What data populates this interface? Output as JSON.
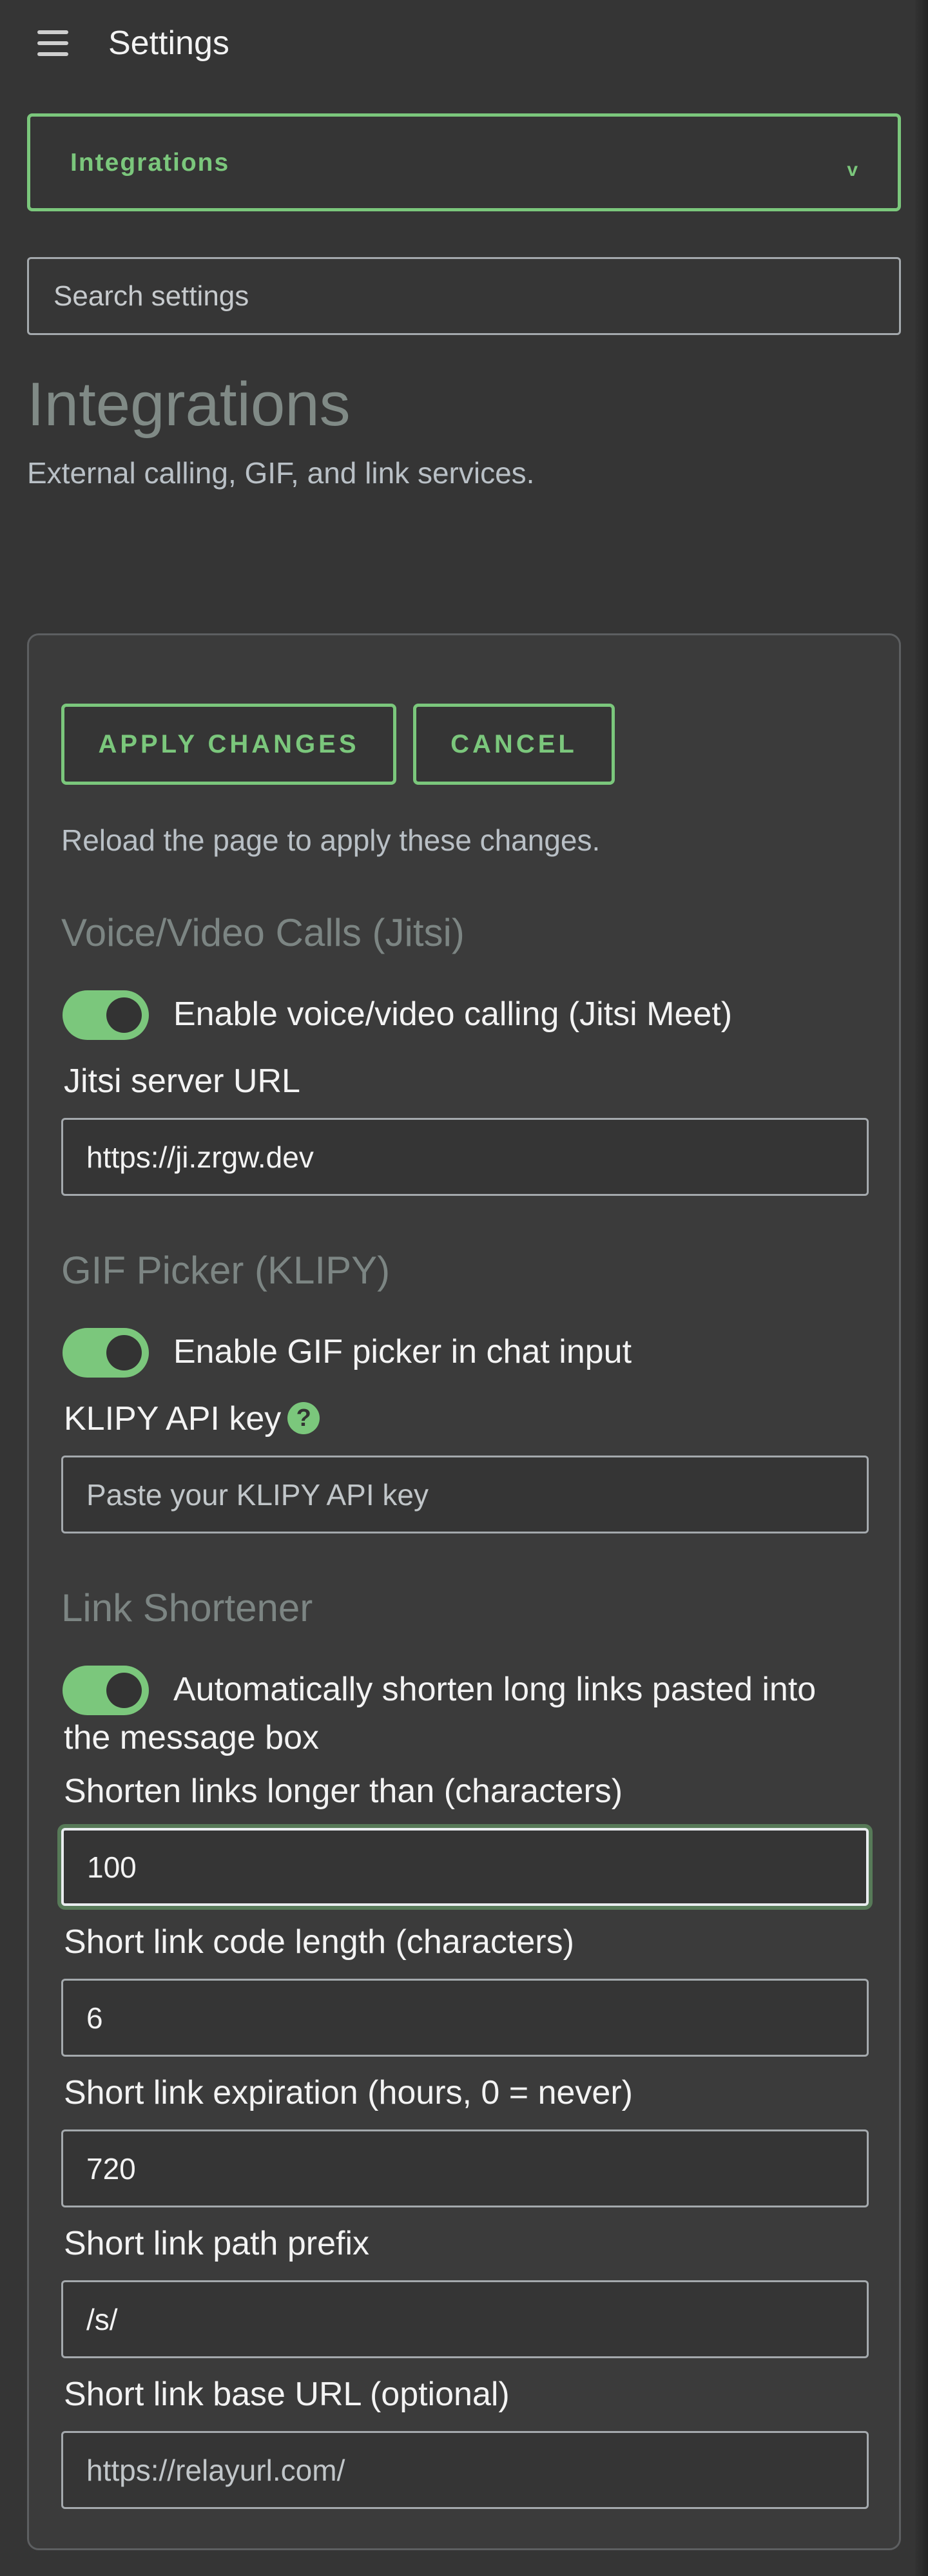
{
  "header": {
    "title": "Settings",
    "menu_icon": "hamburger-menu-icon"
  },
  "category_select": {
    "value": "Integrations",
    "chevron": "v"
  },
  "search": {
    "placeholder": "Search settings",
    "value": ""
  },
  "section": {
    "title": "Integrations",
    "description": "External calling, GIF, and link services."
  },
  "actions": {
    "apply_label": "APPLY CHANGES",
    "cancel_label": "CANCEL",
    "note": "Reload the page to apply these changes."
  },
  "jitsi": {
    "title": "Voice/Video Calls (Jitsi)",
    "toggle_label": "Enable voice/video calling (Jitsi Meet)",
    "toggle_on": true,
    "url_label": "Jitsi server URL",
    "url_value": "https://ji.zrgw.dev"
  },
  "gif": {
    "title": "GIF Picker (KLIPY)",
    "toggle_label": "Enable GIF picker in chat input",
    "toggle_on": true,
    "api_key_label": "KLIPY API key",
    "help_icon": "?",
    "api_key_placeholder": "Paste your KLIPY API key",
    "api_key_value": ""
  },
  "link_shortener": {
    "title": "Link Shortener",
    "toggle_label": "Automatically shorten long links pasted into the message box",
    "toggle_on": true,
    "fields": [
      {
        "label": "Shorten links longer than (characters)",
        "value": "100",
        "placeholder": ""
      },
      {
        "label": "Short link code length (characters)",
        "value": "6",
        "placeholder": ""
      },
      {
        "label": "Short link expiration (hours, 0 = never)",
        "value": "720",
        "placeholder": ""
      },
      {
        "label": "Short link path prefix",
        "value": "/s/",
        "placeholder": ""
      },
      {
        "label": "Short link base URL (optional)",
        "value": "",
        "placeholder": "https://relayurl.com/"
      }
    ]
  },
  "colors": {
    "accent": "#7bc77c",
    "background": "#353535",
    "panel": "#3b3b3b",
    "muted_heading": "#808a86"
  }
}
